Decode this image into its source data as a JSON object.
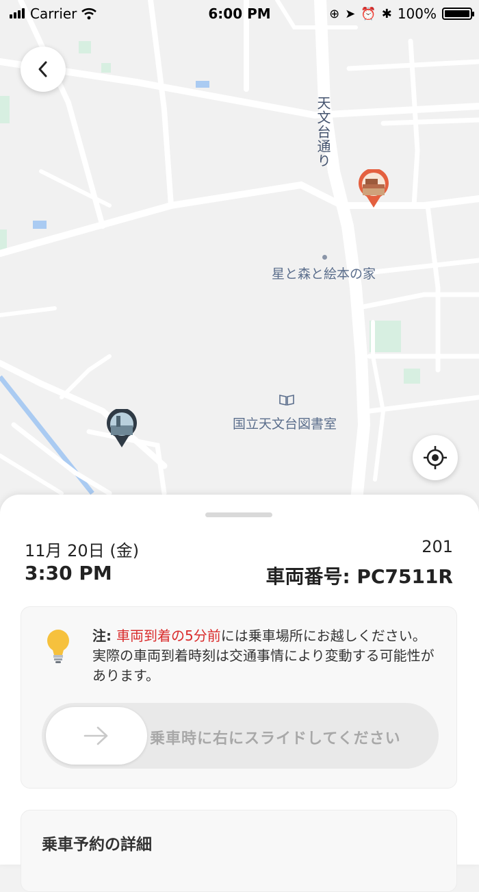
{
  "status_bar": {
    "carrier": "Carrier",
    "time": "6:00 PM",
    "battery": "100%"
  },
  "map": {
    "road_label": "天文台通り",
    "poi_house": "星と森と絵本の家",
    "poi_library": "国立天文台図書室",
    "colors": {
      "background": "#f1f1f1",
      "roads": "#ffffff",
      "park": "#d7efe1",
      "water": "#aacbf2"
    }
  },
  "trip": {
    "date": "11月 20日 (金)",
    "time": "3:30 PM",
    "route": "201",
    "vehicle_label": "車両番号: PC7511R"
  },
  "notice": {
    "prefix": "注: ",
    "highlight": "車両到着の5分前",
    "body": "には乗車場所にお越しください。実際の車両到着時刻は交通事情により変動する可能性があります。"
  },
  "slider": {
    "label": "乗車時に右にスライドしてください"
  },
  "details": {
    "title": "乗車予約の詳細"
  },
  "icons": {
    "back": "chevron-left-icon",
    "locate": "crosshair-icon",
    "notice": "lightbulb-icon",
    "slider": "arrow-right-icon"
  },
  "colors": {
    "accent_red": "#d92b2b",
    "pickup_pin": "#e4603f",
    "dropoff_pin": "#2f3a45",
    "bulb": "#f6c13d"
  }
}
